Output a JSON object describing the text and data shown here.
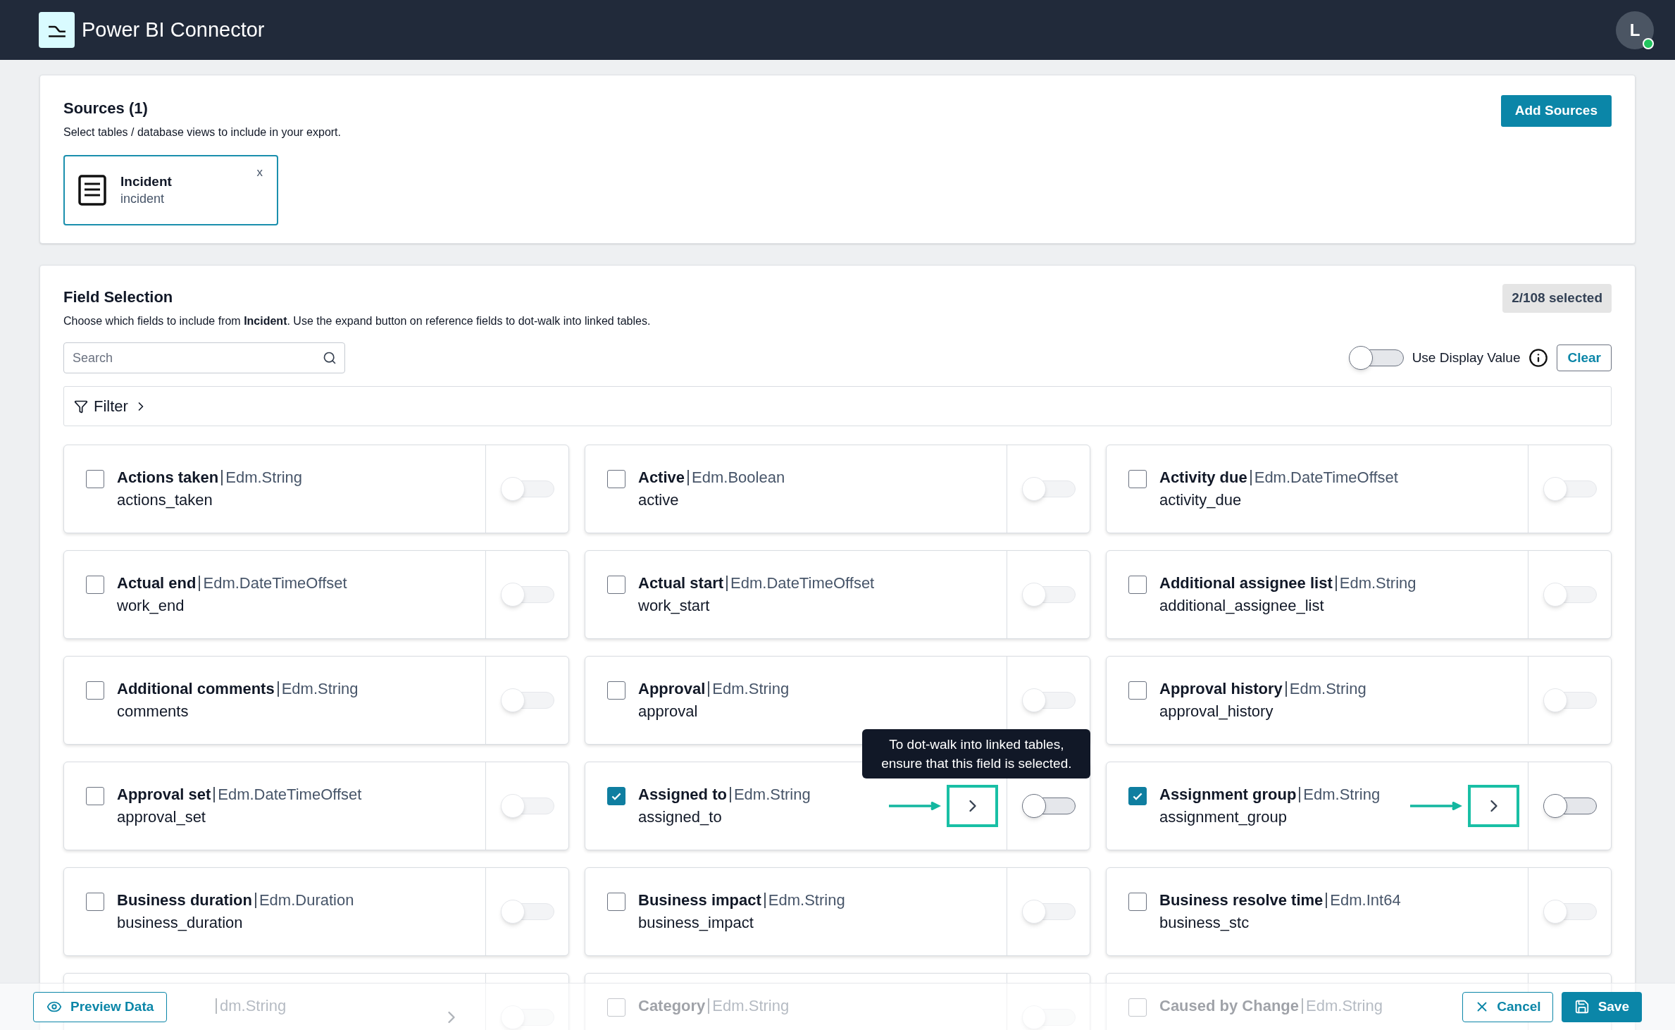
{
  "header": {
    "title": "Power BI Connector",
    "avatar": "L"
  },
  "sources": {
    "title": "Sources (1)",
    "subtitle": "Select tables / database views to include in your export.",
    "add_button": "Add Sources",
    "items": [
      {
        "name": "Incident",
        "table": "incident",
        "remove": "x"
      }
    ]
  },
  "field_selection": {
    "title": "Field Selection",
    "subtitle": "Choose which fields to include from **Incident**. Use the expand button on reference fields to dot-walk into linked tables.",
    "count": "2/108 selected",
    "search_placeholder": "Search",
    "display_toggle": {
      "label": "Use Display Value",
      "on": false
    },
    "clear_button": "Clear",
    "filter_label": "Filter",
    "fields": [
      {
        "name": "Actions taken",
        "type": "Edm.String",
        "api": "actions_taken",
        "checked": false,
        "display_on": false
      },
      {
        "name": "Active",
        "type": "Edm.Boolean",
        "api": "active",
        "checked": false,
        "display_on": false
      },
      {
        "name": "Activity due",
        "type": "Edm.DateTimeOffset",
        "api": "activity_due",
        "checked": false,
        "display_on": false
      },
      {
        "name": "Actual end",
        "type": "Edm.DateTimeOffset",
        "api": "work_end",
        "checked": false,
        "display_on": false
      },
      {
        "name": "Actual start",
        "type": "Edm.DateTimeOffset",
        "api": "work_start",
        "checked": false,
        "display_on": false
      },
      {
        "name": "Additional assignee list",
        "type": "Edm.String",
        "api": "additional_assignee_list",
        "checked": false,
        "display_on": false
      },
      {
        "name": "Additional comments",
        "type": "Edm.String",
        "api": "comments",
        "checked": false,
        "display_on": false
      },
      {
        "name": "Approval",
        "type": "Edm.String",
        "api": "approval",
        "checked": false,
        "display_on": false
      },
      {
        "name": "Approval history",
        "type": "Edm.String",
        "api": "approval_history",
        "checked": false,
        "display_on": false
      },
      {
        "name": "Approval set",
        "type": "Edm.DateTimeOffset",
        "api": "approval_set",
        "checked": false,
        "display_on": false
      },
      {
        "name": "Assigned to",
        "type": "Edm.String",
        "api": "assigned_to",
        "checked": true,
        "display_on": false,
        "expandable": true,
        "highlighted": true
      },
      {
        "name": "Assignment group",
        "type": "Edm.String",
        "api": "assignment_group",
        "checked": true,
        "display_on": false,
        "expandable": true,
        "highlighted": true
      },
      {
        "name": "Business duration",
        "type": "Edm.Duration",
        "api": "business_duration",
        "checked": false,
        "display_on": false
      },
      {
        "name": "Business impact",
        "type": "Edm.String",
        "api": "business_impact",
        "checked": false,
        "display_on": false
      },
      {
        "name": "Business resolve time",
        "type": "Edm.Int64",
        "api": "business_stc",
        "checked": false,
        "display_on": false
      },
      {
        "type": "dm.String",
        "display_on": false,
        "expandable": true,
        "highlighted": false
      },
      {
        "name": "Category",
        "type": "Edm.String",
        "checked": false,
        "display_on": false
      },
      {
        "name": "Caused by Change",
        "type": "Edm.String",
        "checked": false
      }
    ],
    "tooltip": {
      "text": "To dot-walk into linked tables, ensure that this field is selected."
    }
  },
  "footer": {
    "preview_button": "Preview Data",
    "cancel_button": "Cancel",
    "save_button": "Save"
  }
}
